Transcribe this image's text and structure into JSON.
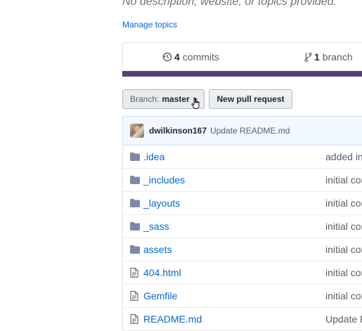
{
  "repo": {
    "description": "No description, website, or topics provided.",
    "manage_topics": "Manage topics"
  },
  "summary": {
    "commits_count": "4",
    "commits_label": "commits",
    "branches_count": "1",
    "branches_label": "branch",
    "language_color": "#563d7c"
  },
  "toolbar": {
    "branch_prefix": "Branch:",
    "branch_name": "master",
    "new_pr_label": "New pull request"
  },
  "latest_commit": {
    "author": "dwilkinson167",
    "message": "Update README.md"
  },
  "files": [
    {
      "type": "folder",
      "name": ".idea",
      "commit": "added in"
    },
    {
      "type": "folder",
      "name": "_includes",
      "commit": "initial com"
    },
    {
      "type": "folder",
      "name": "_layouts",
      "commit": "initial com"
    },
    {
      "type": "folder",
      "name": "_sass",
      "commit": "initial com"
    },
    {
      "type": "folder",
      "name": "assets",
      "commit": "initial com"
    },
    {
      "type": "file",
      "name": "404.html",
      "commit": "initial com"
    },
    {
      "type": "file",
      "name": "Gemfile",
      "commit": "initial com"
    },
    {
      "type": "file",
      "name": "README.md",
      "commit": "Update R"
    }
  ]
}
